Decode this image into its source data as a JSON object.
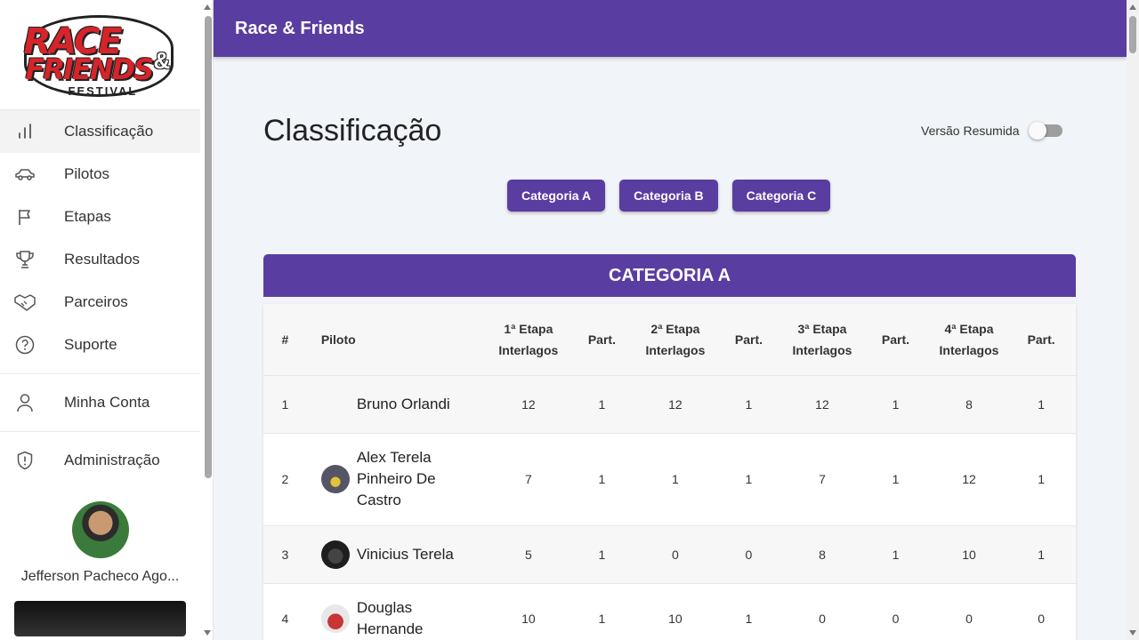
{
  "app": {
    "title": "Race & Friends",
    "logo": {
      "line1": "RACE",
      "amp": "&",
      "line2": "FRIENDS",
      "line3": "FESTIVAL"
    }
  },
  "sidebar": {
    "items": [
      {
        "label": "Classificação",
        "icon": "bar-chart-icon",
        "active": true
      },
      {
        "label": "Pilotos",
        "icon": "car-icon"
      },
      {
        "label": "Etapas",
        "icon": "flag-icon"
      },
      {
        "label": "Resultados",
        "icon": "trophy-icon"
      },
      {
        "label": "Parceiros",
        "icon": "handshake-icon"
      },
      {
        "label": "Suporte",
        "icon": "help-circle-icon"
      }
    ],
    "account": {
      "label": "Minha Conta",
      "icon": "user-icon"
    },
    "admin": {
      "label": "Administração",
      "icon": "shield-icon"
    },
    "profile": {
      "name": "Jefferson Pacheco Ago..."
    }
  },
  "main": {
    "title": "Classificação",
    "toggle_label": "Versão Resumida",
    "toggle_on": false,
    "category_buttons": [
      "Categoria A",
      "Categoria B",
      "Categoria C"
    ],
    "category_title": "CATEGORIA A",
    "table": {
      "headers": [
        "#",
        "Piloto",
        "1ª Etapa Interlagos",
        "Part.",
        "2ª Etapa Interlagos",
        "Part.",
        "3ª Etapa Interlagos",
        "Part.",
        "4ª Etapa Interlagos",
        "Part."
      ],
      "rows": [
        {
          "pos": "1",
          "name": "Bruno Orlandi",
          "avatar": false,
          "values": [
            "12",
            "1",
            "12",
            "1",
            "12",
            "1",
            "8",
            "1"
          ]
        },
        {
          "pos": "2",
          "name": "Alex Terela Pinheiro De Castro",
          "avatar": true,
          "values": [
            "7",
            "1",
            "1",
            "1",
            "7",
            "1",
            "12",
            "1"
          ]
        },
        {
          "pos": "3",
          "name": "Vinicius Terela",
          "avatar": true,
          "values": [
            "5",
            "1",
            "0",
            "0",
            "8",
            "1",
            "10",
            "1"
          ]
        },
        {
          "pos": "4",
          "name": "Douglas Hernande",
          "avatar": true,
          "values": [
            "10",
            "1",
            "10",
            "1",
            "0",
            "0",
            "0",
            "0"
          ]
        }
      ]
    }
  },
  "colors": {
    "primary": "#5a3da0",
    "background": "#f1f4f8"
  }
}
